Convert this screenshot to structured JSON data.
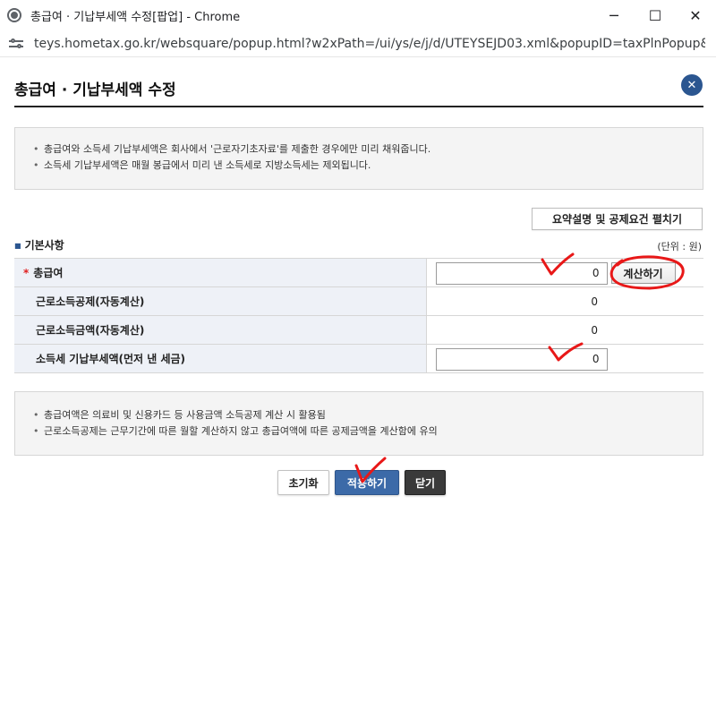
{
  "window": {
    "title": "총급여 · 기납부세액 수정[팝업] - Chrome",
    "minimize": "─",
    "maximize": "☐",
    "close": "✕"
  },
  "address": {
    "url": "teys.hometax.go.kr/websquare/popup.html?w2xPath=/ui/ys/e/j/d/UTEYSEJD03.xml&popupID=taxPlnPopup&idx=idx..."
  },
  "popup": {
    "title": "총급여 · 기납부세액 수정",
    "close_symbol": "✕"
  },
  "info_top": [
    "총급여와 소득세 기납부세액은 회사에서 '근로자기초자료'를 제출한 경우에만 미리 채워줍니다.",
    "소득세 기납부세액은 매월 봉급에서 미리 낸 소득세로 지방소득세는 제외됩니다."
  ],
  "summary_button": "요약설명 및 공제요건 펼치기",
  "section": {
    "title": "기본사항",
    "unit": "(단위 : 원)"
  },
  "rows": {
    "gross_pay": {
      "required_mark": "*",
      "label": "총급여",
      "value": "0",
      "button": "계산하기"
    },
    "earned_income_deduction": {
      "label": "근로소득공제(자동계산)",
      "value": "0"
    },
    "earned_income_amount": {
      "label": "근로소득금액(자동계산)",
      "value": "0"
    },
    "prepaid_tax": {
      "label": "소득세 기납부세액(먼저 낸 세금)",
      "value": "0"
    }
  },
  "info_bottom": [
    "총급여액은 의료비 및 신용카드 등 사용금액 소득공제 계산 시 활용됨",
    "근로소득공제는 근무기간에 따른 월할 계산하지 않고 총급여액에 따른 공제금액을 계산함에 유의"
  ],
  "buttons": {
    "reset": "초기화",
    "apply": "적용하기",
    "close": "닫기"
  },
  "colors": {
    "accent": "#3c6aa8",
    "header_cell": "#eef1f7",
    "annotation": "#e81818"
  }
}
